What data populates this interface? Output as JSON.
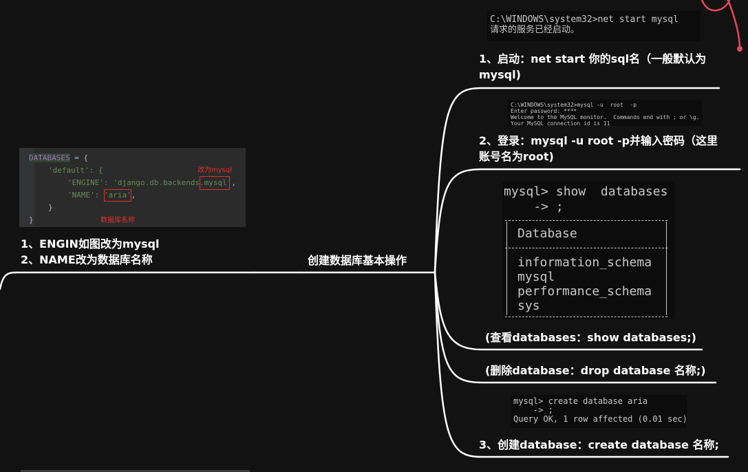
{
  "center": {
    "label": "创建数据库基本操作"
  },
  "left": {
    "code": {
      "line1_var": "DATABASES",
      "line1_rest": " = {",
      "line2": "'default': {",
      "line3_key": "'ENGINE': ",
      "line3_val": "'django.db.backends.mysql'",
      "line3_end": ",",
      "line4_key": "'NAME': ",
      "line4_val": "'aria'",
      "line4_end": ",",
      "line5": "}",
      "line6": "}",
      "anno_engine": "改为mysql",
      "anno_name": "数据库名称"
    },
    "note_line1": "1、ENGIN如图改为mysql",
    "note_line2": "2、NAME改为数据库名称"
  },
  "branches": {
    "start": {
      "terminal": [
        "C:\\WINDOWS\\system32>net start mysql",
        "请求的服务已经启动。"
      ],
      "label_line1": "1、启动：net start 你的sql名（一般默认为",
      "label_line2": "mysql)"
    },
    "login": {
      "terminal": [
        "C:\\WINDOWS\\system32>mysql -u  root  -p",
        "Enter password: ****",
        "Welcome to the MySQL monitor.  Commands end with ; or \\g.",
        "Your MySQL connection id is 11"
      ],
      "label_line1": "2、登录：mysql  -u root -p并输入密码（这里",
      "label_line2": "账号名为root)"
    },
    "show": {
      "terminal": {
        "prompt1": "mysql> show  databases",
        "prompt2": "    -> ;",
        "header": "Database",
        "rows": [
          "information_schema",
          "mysql",
          "performance_schema",
          "sys"
        ]
      },
      "label": "(查看databases：show databases;)"
    },
    "drop": {
      "label": "(删除database：drop database  名称;)"
    },
    "create": {
      "terminal": [
        "mysql> create database aria",
        "    -> ;",
        "Query OK, 1 row affected (0.01 sec)"
      ],
      "label": "3、创建database：create  database  名称;"
    }
  },
  "colors": {
    "background": "#121212",
    "lines": "#ffffff",
    "accent": "#e8455c",
    "code_bg": "#2b2b2b",
    "terminal_bg": "#0c0c0c"
  }
}
